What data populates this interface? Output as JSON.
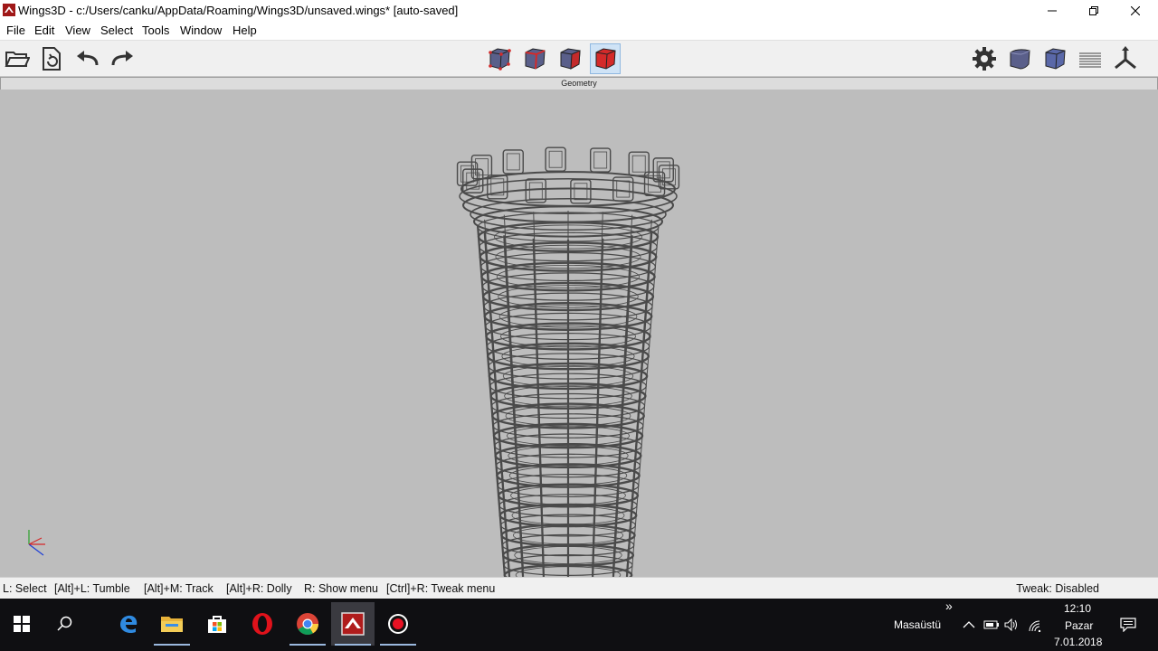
{
  "window": {
    "title": "Wings3D - c:/Users/canku/AppData/Roaming/Wings3D/unsaved.wings* [auto-saved]",
    "minimize_icon": "minimize-icon",
    "restore_icon": "restore-icon",
    "close_icon": "close-icon"
  },
  "menu": {
    "items": [
      "File",
      "Edit",
      "View",
      "Select",
      "Tools",
      "Window",
      "Help"
    ]
  },
  "toolbar": {
    "left_icons": [
      "open-folder-icon",
      "save-icon",
      "undo-icon",
      "redo-icon"
    ],
    "selection_modes": [
      "vertex-mode-icon",
      "edge-mode-icon",
      "face-mode-icon",
      "body-mode-icon"
    ],
    "active_mode": "body-mode-icon",
    "right_icons": [
      "gear-icon",
      "smooth-preview-icon",
      "wireframe-cube-icon",
      "ground-plane-icon",
      "axes-icon"
    ],
    "accent_color": "#d42a2a"
  },
  "viewport": {
    "header": "Geometry",
    "background": "#bdbdbd",
    "wire_color": "#4a4a4a"
  },
  "statusbar": {
    "hints": [
      "L: Select",
      "[Alt]+L: Tumble",
      "[Alt]+M: Track",
      "[Alt]+R: Dolly",
      "R: Show menu",
      "[Ctrl]+R: Tweak menu"
    ],
    "tweak": "Tweak: Disabled"
  },
  "taskbar": {
    "apps": [
      "windows-start-icon",
      "search-icon",
      "edge-icon",
      "file-explorer-icon",
      "store-icon",
      "opera-icon",
      "chrome-icon",
      "wings3d-icon",
      "recorder-icon"
    ],
    "desktop_label": "Masaüstü",
    "chevron": "»",
    "time": "12:10",
    "day": "Pazar",
    "date": "7.01.2018"
  }
}
